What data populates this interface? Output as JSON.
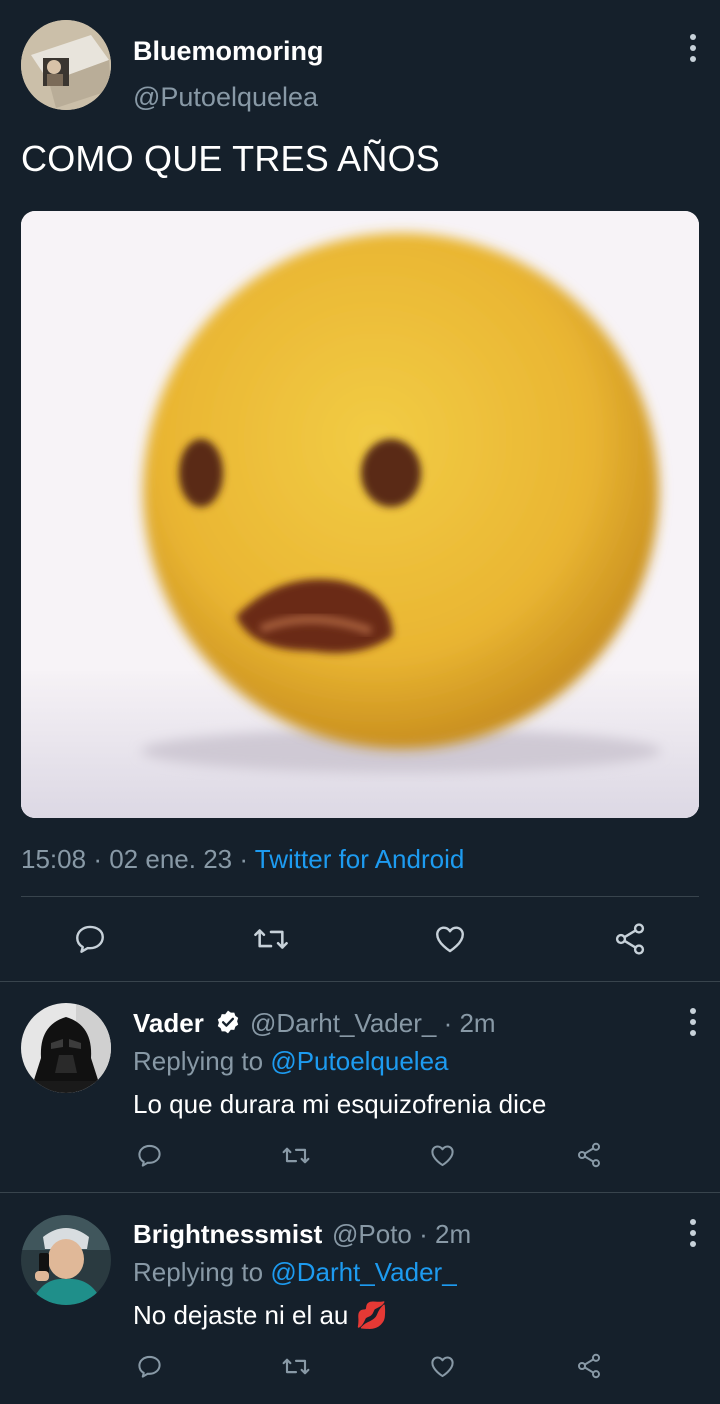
{
  "tweet": {
    "author_name": "Bluemomoring",
    "author_handle": "@Putoelquelea",
    "text": "COMO QUE TRES AÑOS",
    "time": "15:08",
    "date": "02 ene. 23",
    "sep": "·",
    "source": "Twitter for Android"
  },
  "replies": [
    {
      "name": "Vader",
      "verified": true,
      "handle": "@Darht_Vader_",
      "time": "· 2m",
      "replying_label": "Replying to",
      "replying_handle": "@Putoelquelea",
      "text": "Lo que durara mi esquizofrenia dice"
    },
    {
      "name": "Brightnessmist",
      "verified": false,
      "handle": "@Poto",
      "time": "· 2m",
      "replying_label": "Replying to",
      "replying_handle": "@Darht_Vader_",
      "text": "No dejaste ni el au",
      "emoji": "💋"
    }
  ],
  "icons": [
    "more-icon",
    "reply-icon",
    "retweet-icon",
    "like-icon",
    "share-icon",
    "verified-icon"
  ],
  "colors": {
    "background": "#15202b",
    "accent": "#1d9bf0",
    "muted": "#8899a6",
    "divider": "#38444d"
  }
}
